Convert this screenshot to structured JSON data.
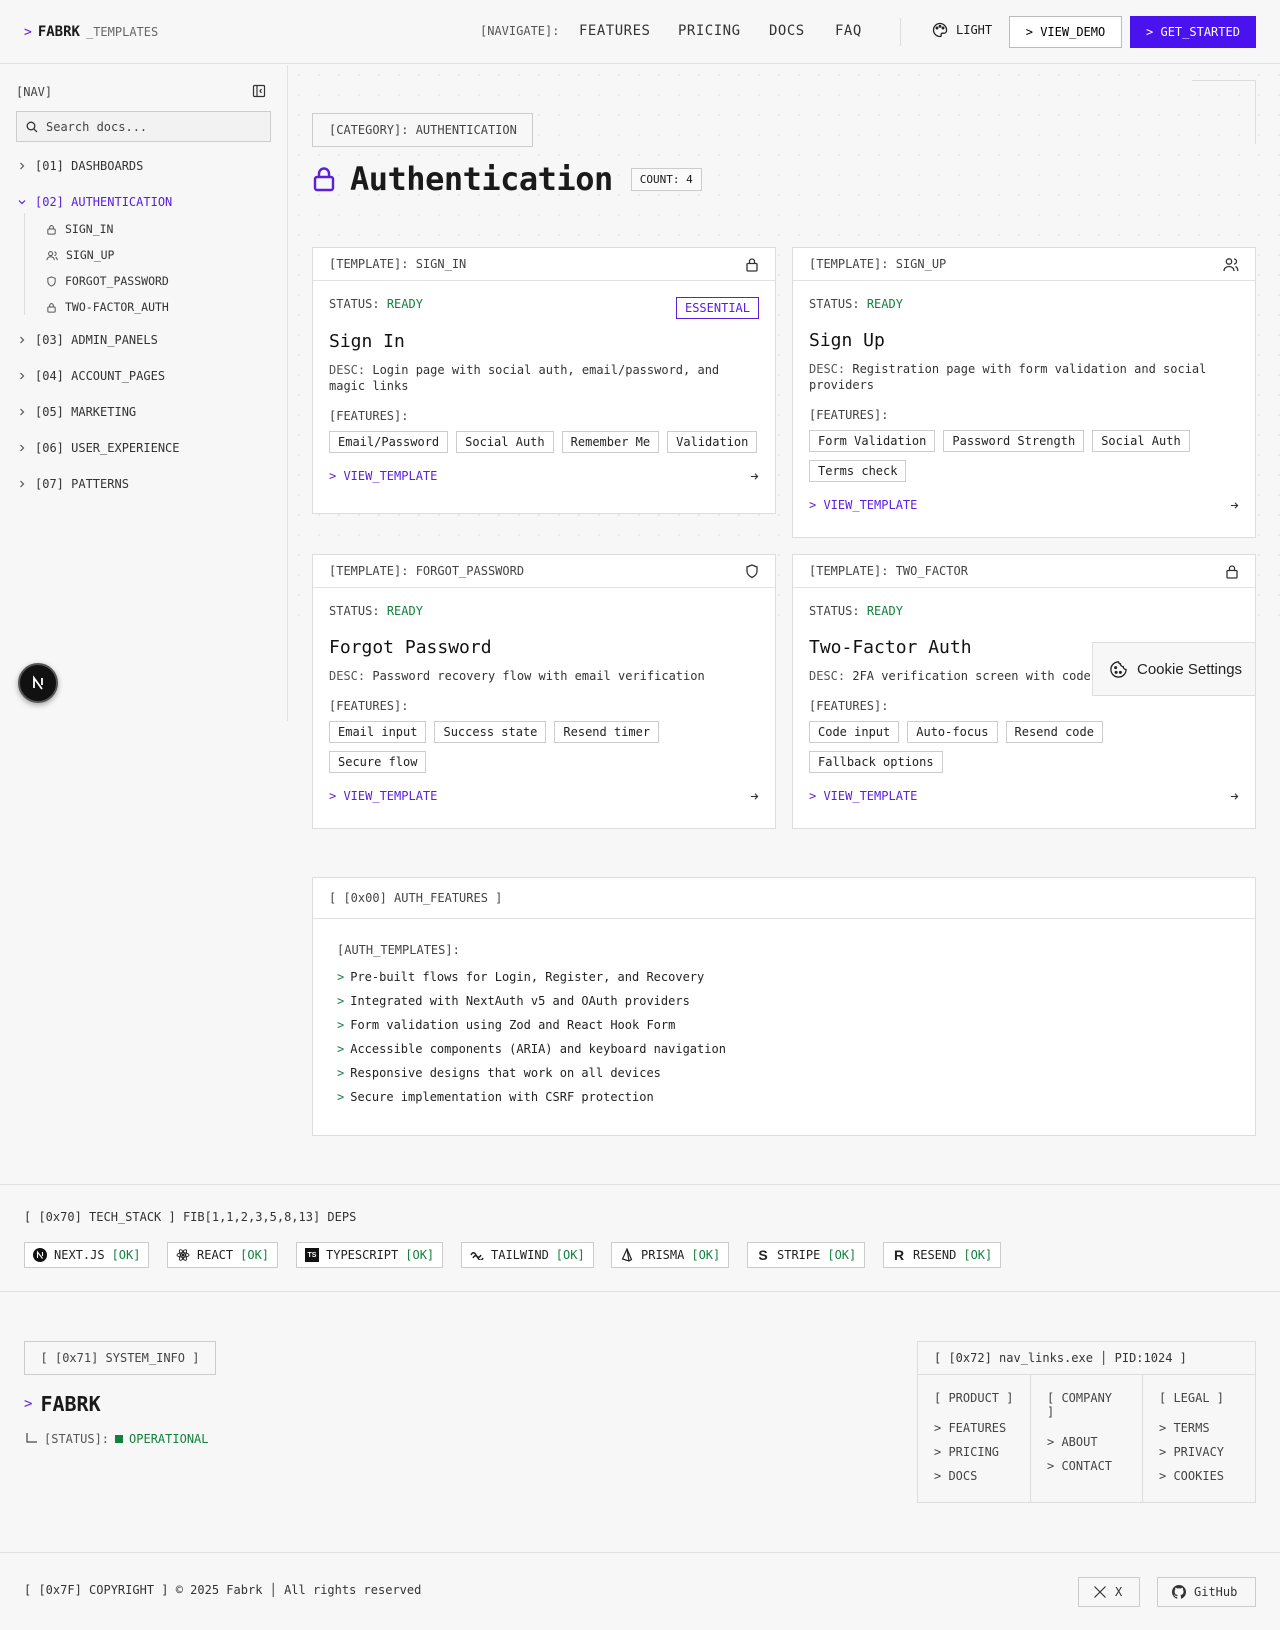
{
  "header": {
    "logo_prompt": ">",
    "logo_name": "FABRK",
    "logo_sub": "_TEMPLATES",
    "nav_label": "[NAVIGATE]:",
    "nav": [
      "FEATURES",
      "PRICING",
      "DOCS",
      "FAQ"
    ],
    "theme_label": "LIGHT",
    "demo_label": "> VIEW_DEMO",
    "start_label": "> GET_STARTED"
  },
  "sidebar": {
    "title": "[NAV]",
    "search_placeholder": "Search docs...",
    "items": [
      {
        "label": "[01] DASHBOARDS"
      },
      {
        "label": "[02] AUTHENTICATION"
      },
      {
        "label": "[03] ADMIN_PANELS"
      },
      {
        "label": "[04] ACCOUNT_PAGES"
      },
      {
        "label": "[05] MARKETING"
      },
      {
        "label": "[06] USER_EXPERIENCE"
      },
      {
        "label": "[07] PATTERNS"
      }
    ],
    "sub_items": [
      {
        "label": "SIGN_IN",
        "icon": "lock-icon"
      },
      {
        "label": "SIGN_UP",
        "icon": "users-icon"
      },
      {
        "label": "FORGOT_PASSWORD",
        "icon": "shield-icon"
      },
      {
        "label": "TWO-FACTOR_AUTH",
        "icon": "lock-icon"
      }
    ]
  },
  "main": {
    "category": "[CATEGORY]: AUTHENTICATION",
    "title": "Authentication",
    "count": "COUNT: 4",
    "status_label": "STATUS:",
    "desc_label": "DESC:",
    "features_label": "[FEATURES]:",
    "view_label": "> VIEW_TEMPLATE",
    "cards": [
      {
        "head": "[TEMPLATE]: SIGN_IN",
        "status": "READY",
        "badge": "ESSENTIAL",
        "title": "Sign In",
        "desc": "Login page with social auth, email/password, and magic links",
        "tags": [
          "Email/Password",
          "Social Auth",
          "Remember Me",
          "Validation"
        ]
      },
      {
        "head": "[TEMPLATE]: SIGN_UP",
        "status": "READY",
        "title": "Sign Up",
        "desc": "Registration page with form validation and social providers",
        "tags": [
          "Form Validation",
          "Password Strength",
          "Social Auth",
          "Terms check"
        ]
      },
      {
        "head": "[TEMPLATE]: FORGOT_PASSWORD",
        "status": "READY",
        "title": "Forgot Password",
        "desc": "Password recovery flow with email verification",
        "tags": [
          "Email input",
          "Success state",
          "Resend timer",
          "Secure flow"
        ]
      },
      {
        "head": "[TEMPLATE]: TWO_FACTOR",
        "status": "READY",
        "title": "Two-Factor Auth",
        "desc": "2FA verification screen with code",
        "tags": [
          "Code input",
          "Auto-focus",
          "Resend code",
          "Fallback options"
        ]
      }
    ],
    "cookie_label": "Cookie Settings",
    "auth_features": {
      "head": "[ [0x00] AUTH_FEATURES ]",
      "label": "[AUTH_TEMPLATES]:",
      "items": [
        "Pre-built flows for Login, Register, and Recovery",
        "Integrated with NextAuth v5 and OAuth providers",
        "Form validation using Zod and React Hook Form",
        "Accessible components (ARIA) and keyboard navigation",
        "Responsive designs that work on all devices",
        "Secure implementation with CSRF protection"
      ]
    }
  },
  "tech_stack": {
    "title": "[ [0x70] TECH_STACK ] FIB[1,1,2,3,5,8,13] DEPS",
    "ok_label": "[OK]",
    "items": [
      "NEXT.JS",
      "REACT",
      "TYPESCRIPT",
      "TAILWIND",
      "PRISMA",
      "STRIPE",
      "RESEND"
    ]
  },
  "footer": {
    "sysinfo": "[ [0x71] SYSTEM_INFO ]",
    "brand": "FABRK",
    "status_label": "[STATUS]:",
    "status_value": "OPERATIONAL",
    "links_head": "[ [0x72] nav_links.exe │ PID:1024 ]",
    "columns": [
      {
        "title": "[ PRODUCT ]",
        "links": [
          "> FEATURES",
          "> PRICING",
          "> DOCS"
        ]
      },
      {
        "title": "[ COMPANY ]",
        "links": [
          "> ABOUT",
          "> CONTACT"
        ]
      },
      {
        "title": "[ LEGAL ]",
        "links": [
          "> TERMS",
          "> PRIVACY",
          "> COOKIES"
        ]
      }
    ],
    "copyright": "[ [0x7F] COPYRIGHT ] © 2025 Fabrk │ All rights reserved",
    "x_label": "X",
    "github_label": "GitHub"
  },
  "colors": {
    "accent": "#4b12f0",
    "ok": "#15803d"
  }
}
